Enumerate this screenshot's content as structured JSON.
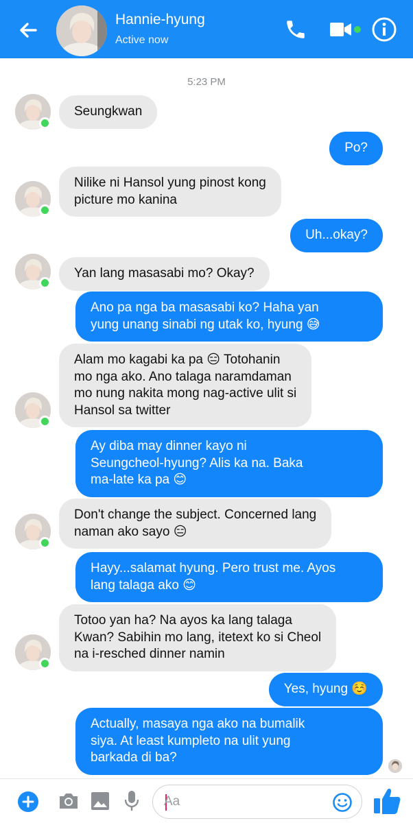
{
  "header": {
    "contact_name": "Hannie-hyung",
    "status": "Active now"
  },
  "chat": {
    "timestamp": "5:23 PM",
    "messages": [
      {
        "sender": "contact",
        "text": "Seungkwan"
      },
      {
        "sender": "me",
        "text": "Po?"
      },
      {
        "sender": "contact",
        "text": "Nilike ni Hansol yung pinost kong\npicture mo kanina"
      },
      {
        "sender": "me",
        "text": "Uh...okay?"
      },
      {
        "sender": "contact",
        "text": "Yan lang masasabi mo? Okay?"
      },
      {
        "sender": "me",
        "text": "Ano pa nga ba masasabi ko? Haha yan\nyung unang sinabi ng utak ko, hyung 😅"
      },
      {
        "sender": "contact",
        "text": "Alam mo kagabi ka pa 😑 Totohanin\nmo nga ako. Ano talaga naramdaman\nmo nung nakita mong nag-active ulit si\nHansol sa twitter"
      },
      {
        "sender": "me",
        "text": "Ay diba may dinner kayo ni\nSeungcheol-hyung? Alis ka na. Baka\nma-late ka pa 😊"
      },
      {
        "sender": "contact",
        "text": "Don't change the subject. Concerned lang\nnaman ako sayo 😑"
      },
      {
        "sender": "me",
        "text": "Hayy...salamat hyung. Pero trust me. Ayos\nlang talaga ako 😊"
      },
      {
        "sender": "contact",
        "text": "Totoo yan ha? Na ayos ka lang talaga\nKwan? Sabihin mo lang, itetext ko si Cheol\nna i-resched dinner namin"
      },
      {
        "sender": "me",
        "text": "Yes, hyung ☺️"
      },
      {
        "sender": "me",
        "text": "Actually, masaya nga ako na bumalik\nsiya. At least kumpleto na ulit yung\nbarkada di ba?"
      }
    ]
  },
  "composer": {
    "placeholder": "Aa"
  },
  "colors": {
    "header_bg": "#1a8cf7",
    "outgoing_bubble": "#1286fa",
    "incoming_bubble": "#e9e9e9",
    "online": "#42d65b"
  },
  "icons": [
    "back-arrow-icon",
    "phone-icon",
    "video-camera-icon",
    "info-icon",
    "plus-icon",
    "camera-icon",
    "image-icon",
    "microphone-icon",
    "emoji-icon",
    "thumbs-up-icon"
  ]
}
